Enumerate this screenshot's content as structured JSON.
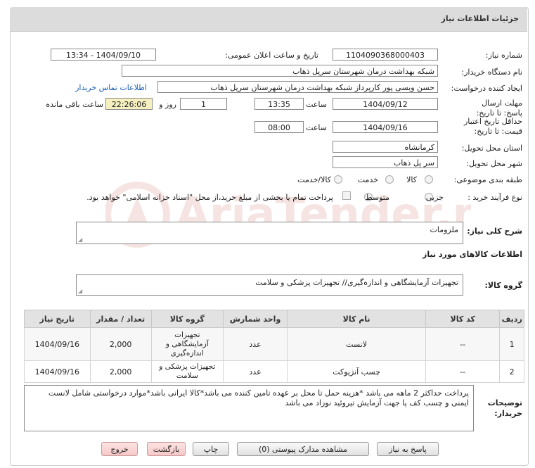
{
  "header": {
    "title": "جزئیات اطلاعات نیاز"
  },
  "fields": {
    "need_number_label": "شماره نیاز:",
    "need_number": "1104090368000403",
    "announce_label": "تاریخ و ساعت اعلان عمومی:",
    "announce_value": "1404/09/10 - 13:34",
    "buyer_org_label": "نام دستگاه خریدار:",
    "buyer_org": "شبکه بهداشت درمان شهرستان سرپل ذهاب",
    "creator_label": "ایجاد کننده درخواست:",
    "creator": "حسن ویسی پور کارپرداز شبکه بهداشت درمان شهرستان سرپل ذهاب",
    "contact_link": "اطلاعات تماس خریدار",
    "reply_deadline_label": "مهلت ارسال پاسخ: تا تاریخ:",
    "reply_date": "1404/09/12",
    "time_label": "ساعت",
    "reply_time": "13:35",
    "days_value": "1",
    "days_label": "روز و",
    "remaining_time": "22:26:06",
    "remaining_label": "ساعت باقی مانده",
    "validity_label": "حداقل تاریخ اعتبار قیمت: تا تاریخ:",
    "validity_date": "1404/09/16",
    "validity_time": "08:00",
    "province_label": "استان محل تحویل:",
    "province": "کرمانشاه",
    "city_label": "شهر محل تحویل:",
    "city": "سر پل ذهاب",
    "category_label": "طبقه بندی موضوعی:",
    "category_options": [
      "کالا",
      "خدمت",
      "کالا/خدمت"
    ],
    "process_label": "نوع فرآیند خرید :",
    "process_options": [
      "جزیی",
      "متوسط"
    ],
    "payment_note": "پرداخت تمام یا بخشی از مبلغ خرید،از محل \"اسناد خزانه اسلامی\" خواهد بود."
  },
  "summary": {
    "label": "شرح کلی نیاز:",
    "value": "ملزومات",
    "goods_info_title": "اطلاعات کالاهای مورد نیاز",
    "group_label": "گروه کالا:",
    "group_value": "تجهیزات آزمایشگاهی و اندازه‌گیری// تجهیزات پزشکی و سلامت"
  },
  "table": {
    "headers": [
      "ردیف",
      "کد کالا",
      "نام کالا",
      "واحد شمارش",
      "گروه کالا",
      "تعداد / مقدار",
      "تاریخ نیاز"
    ],
    "rows": [
      {
        "idx": "1",
        "code": "--",
        "name": "لانست",
        "unit": "عدد",
        "group": "تجهیزات آزمایشگاهی و اندازه‌گیری",
        "qty": "2,000",
        "date": "1404/09/16"
      },
      {
        "idx": "2",
        "code": "--",
        "name": "چسب آنژیوکت",
        "unit": "عدد",
        "group": "تجهیزات پزشکی و سلامت",
        "qty": "2,000",
        "date": "1404/09/16"
      }
    ]
  },
  "notes": {
    "label": "توضیحات خریدار:",
    "text": "پرداخت حداکثر 2 ماهه می باشد *هزینه حمل تا محل بر عهده تامین کننده می باشد*کالا ایرانی باشد*موارد درخواستی شامل لانست  ایمنی و چسب کف پا جهت آزمایش تیروئید  نوزاد می باشد"
  },
  "buttons": {
    "reply": "پاسخ به نیاز",
    "docs": "مشاهده مدارک پیوستی (0)",
    "print": "چاپ",
    "back": "بازگشت",
    "exit": "خروج"
  },
  "watermark": {
    "text": "AriaTender.neT"
  },
  "colors": {
    "header_bg": "#dcdcdc",
    "link": "#1a5fb4",
    "remaining_bg": "#f6f0c0",
    "watermark": "#c0392b"
  }
}
